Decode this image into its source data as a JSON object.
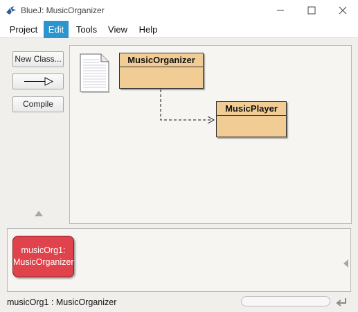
{
  "window": {
    "title": "BlueJ:  MusicOrganizer",
    "icons": [
      "bluej-bird-icon",
      "minimize-icon",
      "maximize-icon",
      "close-icon"
    ]
  },
  "menu": {
    "items": [
      {
        "label": "Project"
      },
      {
        "label": "Edit",
        "active": true
      },
      {
        "label": "Tools"
      },
      {
        "label": "View"
      },
      {
        "label": "Help"
      }
    ]
  },
  "toolbar": {
    "new_class": "New Class...",
    "compile": "Compile",
    "icons": [
      "arrow-right-icon",
      "scroll-up-icon"
    ]
  },
  "diagram": {
    "classes": [
      {
        "name": "MusicOrganizer"
      },
      {
        "name": "MusicPlayer"
      }
    ],
    "readme_icon": "readme-note-icon",
    "dependency": "MusicOrganizer → MusicPlayer"
  },
  "bench": {
    "object_line1": "musicOrg1:",
    "object_line2": "MusicOrganizer",
    "icons": [
      "scroll-left-icon"
    ]
  },
  "status": {
    "text": "musicOrg1 : MusicOrganizer",
    "icons": [
      "reset-machine-icon"
    ]
  },
  "colors": {
    "class_fill": "#f1cc95",
    "object_fill": "#e0434b",
    "menu_active": "#2a95cf"
  }
}
